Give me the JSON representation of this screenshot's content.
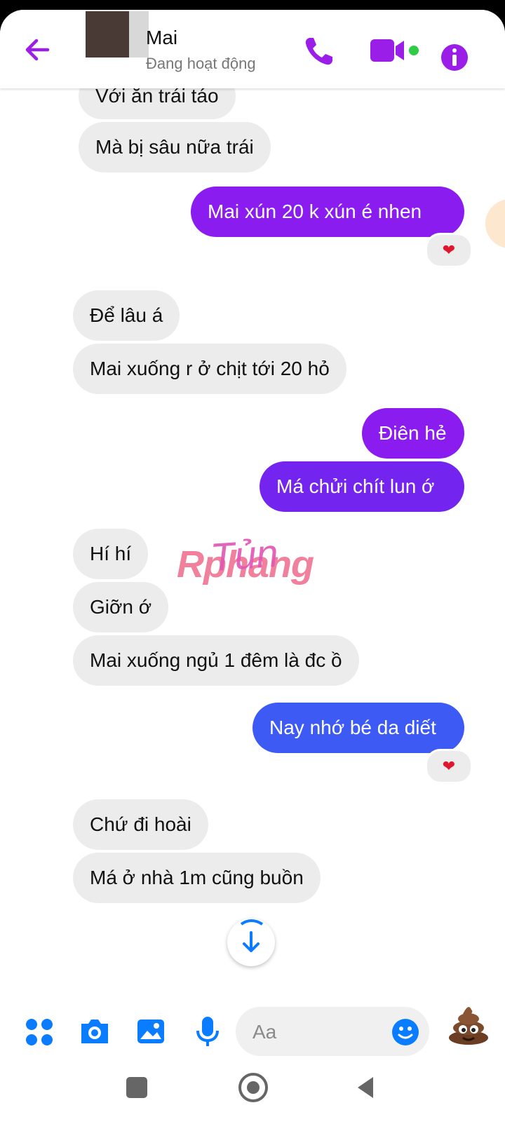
{
  "header": {
    "name": "Mai",
    "status": "Đang hoạt động"
  },
  "messages": [
    {
      "side": "in",
      "text": "Với ăn trái táo"
    },
    {
      "side": "in",
      "text": "Mà bị sâu nữa trái"
    },
    {
      "side": "out",
      "text": "Mai xún 20 k xún é nhen",
      "reaction": "❤"
    },
    {
      "side": "in",
      "text": "Để lâu á"
    },
    {
      "side": "in",
      "text": "Mai xuống r ở chịt tới 20 hỏ"
    },
    {
      "side": "out",
      "text": "Điên hẻ"
    },
    {
      "side": "out",
      "text": "Má chửi chít lun ớ"
    },
    {
      "side": "in",
      "text": "Hí hí"
    },
    {
      "side": "in",
      "text": "Giỡn ớ"
    },
    {
      "side": "in",
      "text": "Mai xuống ngủ 1 đêm là đc ồ"
    },
    {
      "side": "out",
      "text": "Nay nhớ bé da diết",
      "reaction": "❤"
    },
    {
      "side": "in",
      "text": "Chứ đi hoài"
    },
    {
      "side": "in",
      "text": "Má ở nhà 1m cũng buồn"
    }
  ],
  "watermark": {
    "text_a": "Rphang",
    "text_b": "Tủn"
  },
  "composer": {
    "placeholder": "Aa"
  },
  "colors": {
    "accent": "#9b1de8",
    "out_purple": "#8a1cf0",
    "out_violet": "#7424ef",
    "out_blue": "#3d5af5",
    "composer_blue": "#0a7cff",
    "heart": "#e0162b"
  },
  "icons": {
    "back": "arrow-left-icon",
    "call": "phone-icon",
    "video": "video-camera-icon",
    "info": "info-icon",
    "menu": "grid-dots-icon",
    "camera": "camera-icon",
    "gallery": "image-icon",
    "mic": "microphone-icon",
    "emoji": "smiley-icon",
    "sticker": "poop-emoji-icon",
    "scroll": "arrow-down-icon"
  }
}
